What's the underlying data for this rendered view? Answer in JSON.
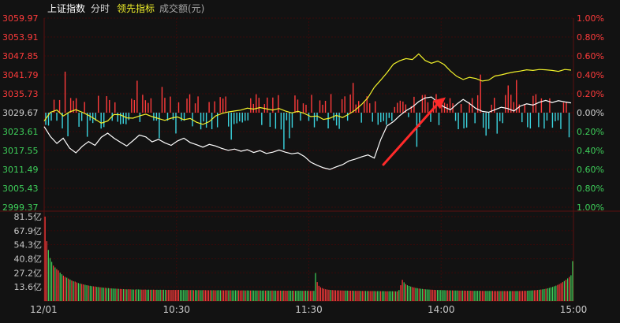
{
  "header": {
    "index_name": "上证指数",
    "mode": "分时",
    "leading_indicator": "领先指标",
    "volume_label": "成交额(元)"
  },
  "colors": {
    "background": "#121212",
    "grid": "#3a0a0a",
    "up": "#ff3b3b",
    "down": "#3bd5e0",
    "index_line": "#ffffff",
    "leading_line": "#f2f22a",
    "arrow": "#ff2a2a",
    "vol_up": "#ff3b3b",
    "vol_down": "#3ed05a"
  },
  "chart_data": {
    "type": "line",
    "title": "上证指数 分时",
    "prev_close": 3029.67,
    "y_left_ticks": [
      "3059.97",
      "3053.91",
      "3047.85",
      "3041.79",
      "3035.73",
      "3029.67",
      "3023.61",
      "3017.55",
      "3011.49",
      "3005.43",
      "2999.37"
    ],
    "y_right_ticks": [
      "1.00%",
      "0.80%",
      "0.60%",
      "0.40%",
      "0.20%",
      "0.00%",
      "0.20%",
      "0.40%",
      "0.60%",
      "0.80%",
      "1.00%"
    ],
    "ylim": [
      2999.37,
      3059.97
    ],
    "x_ticks": [
      "12/01",
      "10:30",
      "11:30",
      "14:00",
      "15:00"
    ],
    "series": [
      {
        "name": "上证指数",
        "values": [
          3025.2,
          3022.0,
          3019.8,
          3021.5,
          3018.3,
          3016.8,
          3018.9,
          3020.4,
          3019.2,
          3021.8,
          3023.1,
          3021.5,
          3020.2,
          3019.0,
          3020.7,
          3022.5,
          3021.9,
          3020.3,
          3021.1,
          3020.0,
          3019.2,
          3020.6,
          3021.5,
          3020.1,
          3019.4,
          3018.6,
          3019.5,
          3019.0,
          3018.2,
          3017.6,
          3018.0,
          3017.3,
          3017.8,
          3016.9,
          3017.5,
          3016.6,
          3017.0,
          3017.7,
          3017.0,
          3016.5,
          3016.8,
          3015.6,
          3013.8,
          3012.8,
          3012.0,
          3011.5,
          3012.3,
          3013.0,
          3014.2,
          3014.8,
          3015.5,
          3016.1,
          3015.1,
          3021.0,
          3025.4,
          3026.8,
          3028.7,
          3030.3,
          3031.5,
          3033.2,
          3034.4,
          3034.7,
          3033.0,
          3031.5,
          3030.6,
          3032.4,
          3033.9,
          3032.6,
          3031.0,
          3030.1,
          3029.8,
          3030.6,
          3031.4,
          3031.0,
          3030.2,
          3031.8,
          3032.5,
          3032.1,
          3033.0,
          3033.6,
          3032.9,
          3033.5,
          3033.1,
          3032.8
        ],
        "note": "minute-sampled approximation"
      },
      {
        "name": "领先指标",
        "values": [
          3027.0,
          3029.8,
          3030.5,
          3028.6,
          3029.9,
          3030.6,
          3029.8,
          3028.8,
          3027.6,
          3026.3,
          3027.0,
          3029.1,
          3029.0,
          3028.0,
          3027.9,
          3028.6,
          3029.2,
          3028.4,
          3027.8,
          3027.2,
          3027.9,
          3028.3,
          3027.4,
          3027.8,
          3026.6,
          3025.9,
          3026.8,
          3028.6,
          3029.4,
          3029.9,
          3030.2,
          3030.5,
          3031.1,
          3030.8,
          3031.3,
          3030.9,
          3030.5,
          3031.0,
          3030.2,
          3029.6,
          3030.1,
          3029.4,
          3028.4,
          3028.6,
          3027.5,
          3027.9,
          3028.8,
          3028.1,
          3029.2,
          3030.5,
          3032.3,
          3034.5,
          3037.8,
          3040.1,
          3042.5,
          3045.2,
          3046.3,
          3047.0,
          3046.7,
          3048.5,
          3046.4,
          3045.5,
          3046.2,
          3045.1,
          3043.0,
          3041.3,
          3040.3,
          3041.0,
          3040.6,
          3039.8,
          3040.1,
          3041.4,
          3041.8,
          3042.3,
          3042.7,
          3043.0,
          3043.4,
          3043.2,
          3043.5,
          3043.4,
          3043.2,
          3042.9,
          3043.5,
          3043.3
        ]
      }
    ],
    "volume": {
      "ylabel": "成交额(元)",
      "ticks": [
        "81.5亿",
        "67.9亿",
        "54.3亿",
        "40.8亿",
        "27.2亿",
        "13.6亿"
      ],
      "ylim_yi": [
        0,
        81.5
      ],
      "values_yi": [
        81.5,
        57.8,
        49.3,
        41.5,
        37.8,
        34.2,
        32.4,
        30.8,
        29.5,
        27.4,
        25.8,
        24.5,
        23.2,
        22.5,
        21.6,
        20.7,
        19.8,
        19.0,
        18.7,
        17.9,
        17.3,
        16.8,
        16.4,
        16.0,
        15.6,
        15.2,
        14.9,
        14.6,
        14.3,
        14.1,
        13.9,
        13.6,
        13.4,
        13.2,
        13.0,
        12.8,
        12.7,
        12.5,
        12.4,
        12.2,
        12.1,
        12.0,
        11.9,
        11.8,
        11.7,
        11.6,
        11.5,
        11.4,
        11.3,
        11.2,
        11.3,
        11.2,
        11.1,
        11.0,
        11.0,
        11.2,
        11.1,
        11.0,
        10.9,
        10.9,
        11.0,
        10.8,
        10.9,
        10.8,
        10.8,
        10.9,
        10.7,
        10.8,
        10.7,
        10.8,
        10.7,
        10.8,
        10.7,
        10.6,
        10.7,
        10.6,
        10.6,
        10.7,
        10.6,
        10.6,
        10.7,
        10.6,
        10.5,
        10.6,
        10.5,
        10.6,
        10.5,
        10.5,
        10.6,
        10.4,
        10.5,
        10.4,
        10.5,
        10.4,
        10.4,
        10.5,
        10.4,
        10.4,
        10.3,
        10.4,
        10.3,
        10.4,
        10.3,
        10.3,
        10.4,
        10.3,
        10.3,
        10.2,
        10.3,
        10.3,
        10.2,
        10.3,
        10.2,
        10.2,
        10.3,
        10.2,
        10.2,
        10.1,
        10.2,
        10.2,
        10.1,
        10.2,
        10.1,
        10.1,
        10.2,
        10.1,
        10.1,
        10.1,
        10.1,
        10.1,
        10.0,
        10.1,
        10.0,
        10.1,
        10.0,
        10.0,
        10.1,
        10.0,
        10.0,
        9.9,
        10.0,
        10.0,
        9.9,
        10.0,
        9.9,
        9.9,
        10.0,
        9.9,
        9.9,
        9.9,
        9.8,
        9.9,
        9.8,
        9.9,
        9.8,
        9.8,
        9.9,
        9.8,
        9.8,
        9.7,
        9.8,
        9.8,
        27.0,
        18.2,
        14.6,
        13.2,
        12.4,
        11.8,
        11.3,
        11.0,
        10.8,
        10.6,
        10.5,
        10.4,
        10.3,
        10.2,
        10.2,
        10.1,
        10.1,
        10.0,
        10.0,
        10.0,
        9.9,
        9.9,
        9.9,
        9.8,
        9.8,
        9.8,
        9.8,
        9.7,
        9.7,
        9.7,
        9.7,
        9.6,
        9.6,
        9.6,
        9.6,
        9.6,
        9.5,
        9.5,
        9.5,
        9.5,
        9.5,
        9.5,
        9.4,
        9.4,
        9.4,
        9.4,
        9.4,
        9.4,
        9.3,
        9.3,
        10.5,
        15.2,
        20.4,
        18.0,
        16.4,
        15.2,
        14.5,
        13.9,
        13.4,
        13.0,
        12.6,
        12.3,
        12.0,
        11.8,
        11.6,
        11.4,
        11.2,
        11.1,
        11.0,
        10.9,
        10.8,
        10.7,
        10.6,
        10.6,
        10.5,
        10.5,
        10.4,
        10.4,
        10.3,
        10.3,
        10.2,
        10.2,
        10.2,
        10.1,
        10.1,
        10.1,
        10.0,
        10.0,
        10.0,
        10.0,
        9.9,
        9.9,
        9.9,
        9.9,
        9.8,
        9.8,
        9.8,
        9.8,
        9.8,
        9.8,
        9.7,
        9.7,
        9.7,
        9.7,
        9.7,
        9.7,
        9.7,
        9.6,
        9.6,
        9.6,
        9.6,
        9.6,
        9.6,
        9.6,
        9.6,
        9.6,
        9.6,
        9.6,
        9.6,
        9.6,
        9.6,
        9.6,
        9.6,
        9.7,
        9.7,
        9.8,
        9.8,
        9.9,
        10.0,
        10.1,
        10.2,
        10.3,
        10.4,
        10.6,
        10.8,
        11.0,
        11.2,
        11.5,
        11.8,
        12.2,
        12.6,
        13.1,
        13.6,
        14.2,
        14.8,
        15.5,
        16.3,
        17.2,
        18.2,
        19.3,
        20.5,
        21.8,
        23.2,
        24.8,
        38.5
      ]
    }
  }
}
